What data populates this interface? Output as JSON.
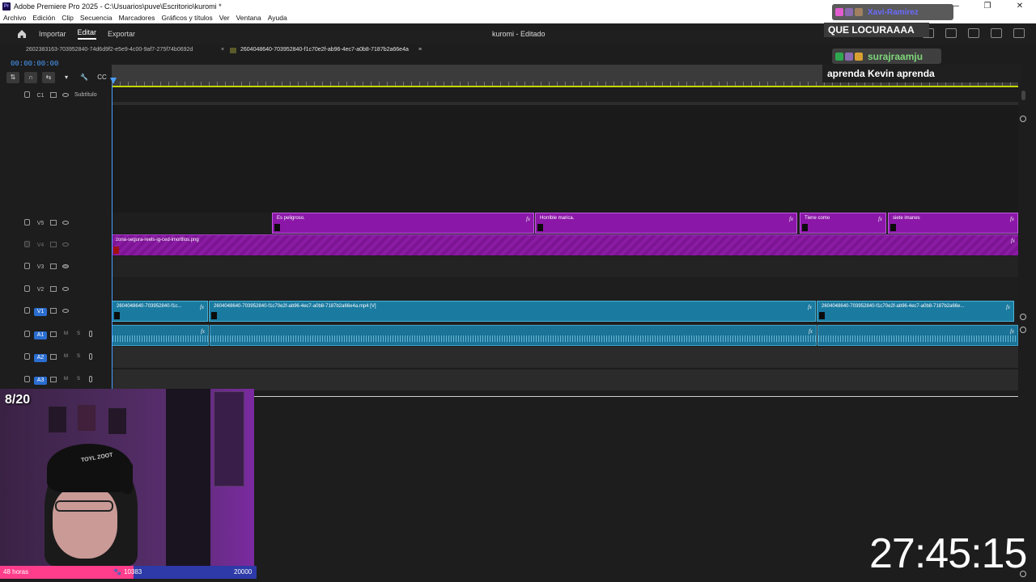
{
  "window": {
    "title": "Adobe Premiere Pro 2025 - C:\\Usuarios\\puve\\Escritorio\\kuromi *",
    "app_icon": "Pr",
    "controls": [
      "—",
      "❐",
      "✕"
    ]
  },
  "menu": [
    "Archivo",
    "Edición",
    "Clip",
    "Secuencia",
    "Marcadores",
    "Gráficos y títulos",
    "Ver",
    "Ventana",
    "Ayuda"
  ],
  "header": {
    "nav": [
      "Importar",
      "Editar",
      "Exportar"
    ],
    "active_nav": "Editar",
    "project_title": "kuromi - Editado"
  },
  "tabs": [
    {
      "label": "2602383163-703952840-74d6d9f2-e5e9-4c00-9af7-275f74b0692d",
      "active": false
    },
    {
      "label": "2604048640-703952840-f1c70e2f-ab96-4ec7-a0b8-7187b2a66e4a",
      "active": true,
      "close": "×",
      "menu": "≡"
    }
  ],
  "timecode": "00:00:00:00",
  "tools": [
    "⇅",
    "∩",
    "⇆",
    "▾",
    "🔧",
    "CC"
  ],
  "tracks": {
    "c1": {
      "name": "C1",
      "label": "Subtítulo"
    },
    "v5": {
      "name": "V5"
    },
    "v4": {
      "name": "V4"
    },
    "v3": {
      "name": "V3"
    },
    "v2": {
      "name": "V2"
    },
    "v1": {
      "name": "V1"
    },
    "a1": {
      "name": "A1",
      "m": "M",
      "s": "S"
    },
    "a2": {
      "name": "A2",
      "m": "M",
      "s": "S"
    },
    "a3": {
      "name": "A3",
      "m": "M",
      "s": "S"
    }
  },
  "clips": {
    "v5": [
      "Es peligroso.",
      "Horrible marica.",
      "Tiene como",
      "siete imanes"
    ],
    "v4": "zona-segura-reels-ig-ced-imortllos.png",
    "v1": [
      "2604048640-703952840-f1c...",
      "2604048640-703952840-f1c70e2f-ab96-4ec7-a0b8-7187b2a66e4a.mp4 [V]",
      "2604048640-703952840-f1c70e2f-ab96-4ec7-a0b8-7187b2a66e..."
    ],
    "fx": "fx"
  },
  "overlay": {
    "chat1_user": "Xavi-Ramirez",
    "chat1_msg": "QUE LOCURAAAA",
    "chat2_user": "surajraamju",
    "chat2_msg": "aprenda Kevin aprenda",
    "counter": "8/20",
    "sub_goal_left": "48 horas",
    "sub_goal_current": "10383",
    "sub_goal_target": "20000",
    "sub_goal_progress": 0.52,
    "big_timer": "27:45:15",
    "cap_text": "TOYL ZOOT"
  },
  "colors": {
    "accent_blue": "#4a9eff",
    "clip_purple": "#8b17a8",
    "clip_teal": "#1a7aa0",
    "goal_pink": "#ff3d8b",
    "goal_blue": "#2e3aa8"
  }
}
